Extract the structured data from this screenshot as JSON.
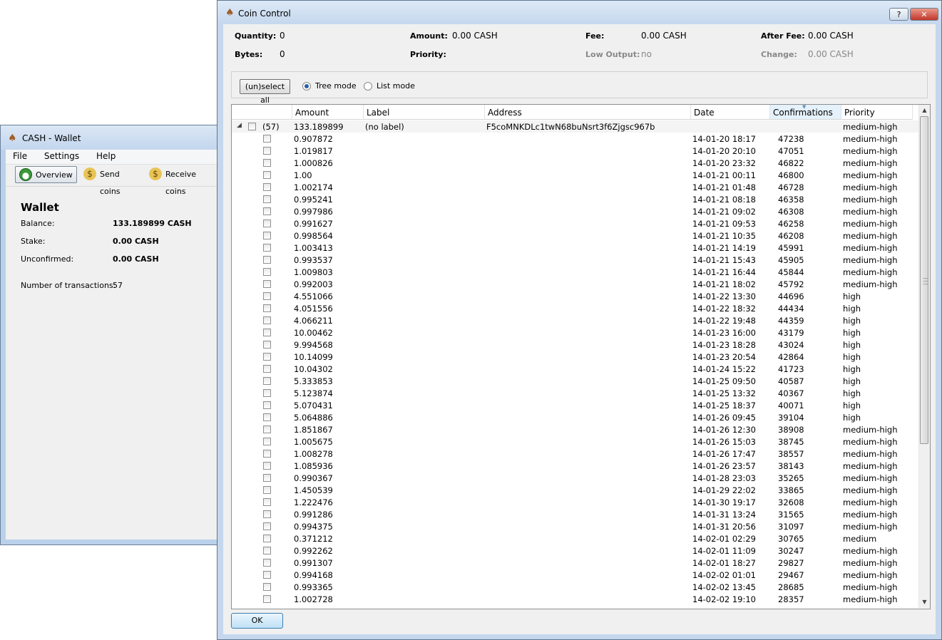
{
  "wallet": {
    "title": "CASH - Wallet",
    "menu": [
      "File",
      "Settings",
      "Help"
    ],
    "toolbar": {
      "overview": "Overview",
      "send": "Send coins",
      "receive": "Receive coins"
    },
    "heading": "Wallet",
    "balance_label": "Balance:",
    "balance": "133.189899 CASH",
    "stake_label": "Stake:",
    "stake": "0.00 CASH",
    "unconfirmed_label": "Unconfirmed:",
    "unconfirmed": "0.00 CASH",
    "tx_label": "Number of transactions:",
    "tx_count": "57"
  },
  "dialog": {
    "title": "Coin Control",
    "help_btn": "?",
    "close_btn": "✕",
    "summary": {
      "quantity_label": "Quantity:",
      "quantity": "0",
      "bytes_label": "Bytes:",
      "bytes": "0",
      "amount_label": "Amount:",
      "amount": "0.00 CASH",
      "priority_label": "Priority:",
      "priority": "",
      "fee_label": "Fee:",
      "fee": "0.00 CASH",
      "lowoutput_label": "Low Output:",
      "lowoutput": "no",
      "afterfee_label": "After Fee:",
      "afterfee": "0.00 CASH",
      "change_label": "Change:",
      "change": "0.00 CASH"
    },
    "select_all": "(un)select all",
    "tree_mode": "Tree mode",
    "list_mode": "List mode",
    "mode": "tree",
    "columns": [
      "Amount",
      "Label",
      "Address",
      "Date",
      "Confirmations",
      "Priority"
    ],
    "sorted_column": "Confirmations",
    "parent": {
      "count": "(57)",
      "amount": "133.189899",
      "label": "(no label)",
      "address": "F5coMNKDLc1twN68buNsrt3f6Zjgsc967b",
      "priority": "medium-high"
    },
    "rows": [
      {
        "amount": "0.907872",
        "date": "14-01-20 18:17",
        "conf": "47238",
        "priority": "medium-high"
      },
      {
        "amount": "1.019817",
        "date": "14-01-20 20:10",
        "conf": "47051",
        "priority": "medium-high"
      },
      {
        "amount": "1.000826",
        "date": "14-01-20 23:32",
        "conf": "46822",
        "priority": "medium-high"
      },
      {
        "amount": "1.00",
        "date": "14-01-21 00:11",
        "conf": "46800",
        "priority": "medium-high"
      },
      {
        "amount": "1.002174",
        "date": "14-01-21 01:48",
        "conf": "46728",
        "priority": "medium-high"
      },
      {
        "amount": "0.995241",
        "date": "14-01-21 08:18",
        "conf": "46358",
        "priority": "medium-high"
      },
      {
        "amount": "0.997986",
        "date": "14-01-21 09:02",
        "conf": "46308",
        "priority": "medium-high"
      },
      {
        "amount": "0.991627",
        "date": "14-01-21 09:53",
        "conf": "46258",
        "priority": "medium-high"
      },
      {
        "amount": "0.998564",
        "date": "14-01-21 10:35",
        "conf": "46208",
        "priority": "medium-high"
      },
      {
        "amount": "1.003413",
        "date": "14-01-21 14:19",
        "conf": "45991",
        "priority": "medium-high"
      },
      {
        "amount": "0.993537",
        "date": "14-01-21 15:43",
        "conf": "45905",
        "priority": "medium-high"
      },
      {
        "amount": "1.009803",
        "date": "14-01-21 16:44",
        "conf": "45844",
        "priority": "medium-high"
      },
      {
        "amount": "0.992003",
        "date": "14-01-21 18:02",
        "conf": "45792",
        "priority": "medium-high"
      },
      {
        "amount": "4.551066",
        "date": "14-01-22 13:30",
        "conf": "44696",
        "priority": "high"
      },
      {
        "amount": "4.051556",
        "date": "14-01-22 18:32",
        "conf": "44434",
        "priority": "high"
      },
      {
        "amount": "4.066211",
        "date": "14-01-22 19:48",
        "conf": "44359",
        "priority": "high"
      },
      {
        "amount": "10.00462",
        "date": "14-01-23 16:00",
        "conf": "43179",
        "priority": "high"
      },
      {
        "amount": "9.994568",
        "date": "14-01-23 18:28",
        "conf": "43024",
        "priority": "high"
      },
      {
        "amount": "10.14099",
        "date": "14-01-23 20:54",
        "conf": "42864",
        "priority": "high"
      },
      {
        "amount": "10.04302",
        "date": "14-01-24 15:22",
        "conf": "41723",
        "priority": "high"
      },
      {
        "amount": "5.333853",
        "date": "14-01-25 09:50",
        "conf": "40587",
        "priority": "high"
      },
      {
        "amount": "5.123874",
        "date": "14-01-25 13:32",
        "conf": "40367",
        "priority": "high"
      },
      {
        "amount": "5.070431",
        "date": "14-01-25 18:37",
        "conf": "40071",
        "priority": "high"
      },
      {
        "amount": "5.064886",
        "date": "14-01-26 09:45",
        "conf": "39104",
        "priority": "high"
      },
      {
        "amount": "1.851867",
        "date": "14-01-26 12:30",
        "conf": "38908",
        "priority": "medium-high"
      },
      {
        "amount": "1.005675",
        "date": "14-01-26 15:03",
        "conf": "38745",
        "priority": "medium-high"
      },
      {
        "amount": "1.008278",
        "date": "14-01-26 17:47",
        "conf": "38557",
        "priority": "medium-high"
      },
      {
        "amount": "1.085936",
        "date": "14-01-26 23:57",
        "conf": "38143",
        "priority": "medium-high"
      },
      {
        "amount": "0.990367",
        "date": "14-01-28 23:03",
        "conf": "35265",
        "priority": "medium-high"
      },
      {
        "amount": "1.450539",
        "date": "14-01-29 22:02",
        "conf": "33865",
        "priority": "medium-high"
      },
      {
        "amount": "1.222476",
        "date": "14-01-30 19:17",
        "conf": "32608",
        "priority": "medium-high"
      },
      {
        "amount": "0.991286",
        "date": "14-01-31 13:24",
        "conf": "31565",
        "priority": "medium-high"
      },
      {
        "amount": "0.994375",
        "date": "14-01-31 20:56",
        "conf": "31097",
        "priority": "medium-high"
      },
      {
        "amount": "0.371212",
        "date": "14-02-01 02:29",
        "conf": "30765",
        "priority": "medium"
      },
      {
        "amount": "0.992262",
        "date": "14-02-01 11:09",
        "conf": "30247",
        "priority": "medium-high"
      },
      {
        "amount": "0.991307",
        "date": "14-02-01 18:27",
        "conf": "29827",
        "priority": "medium-high"
      },
      {
        "amount": "0.994168",
        "date": "14-02-02 01:01",
        "conf": "29467",
        "priority": "medium-high"
      },
      {
        "amount": "0.993365",
        "date": "14-02-02 13:45",
        "conf": "28685",
        "priority": "medium-high"
      },
      {
        "amount": "1.002728",
        "date": "14-02-02 19:10",
        "conf": "28357",
        "priority": "medium-high"
      }
    ],
    "ok_btn": "OK"
  }
}
